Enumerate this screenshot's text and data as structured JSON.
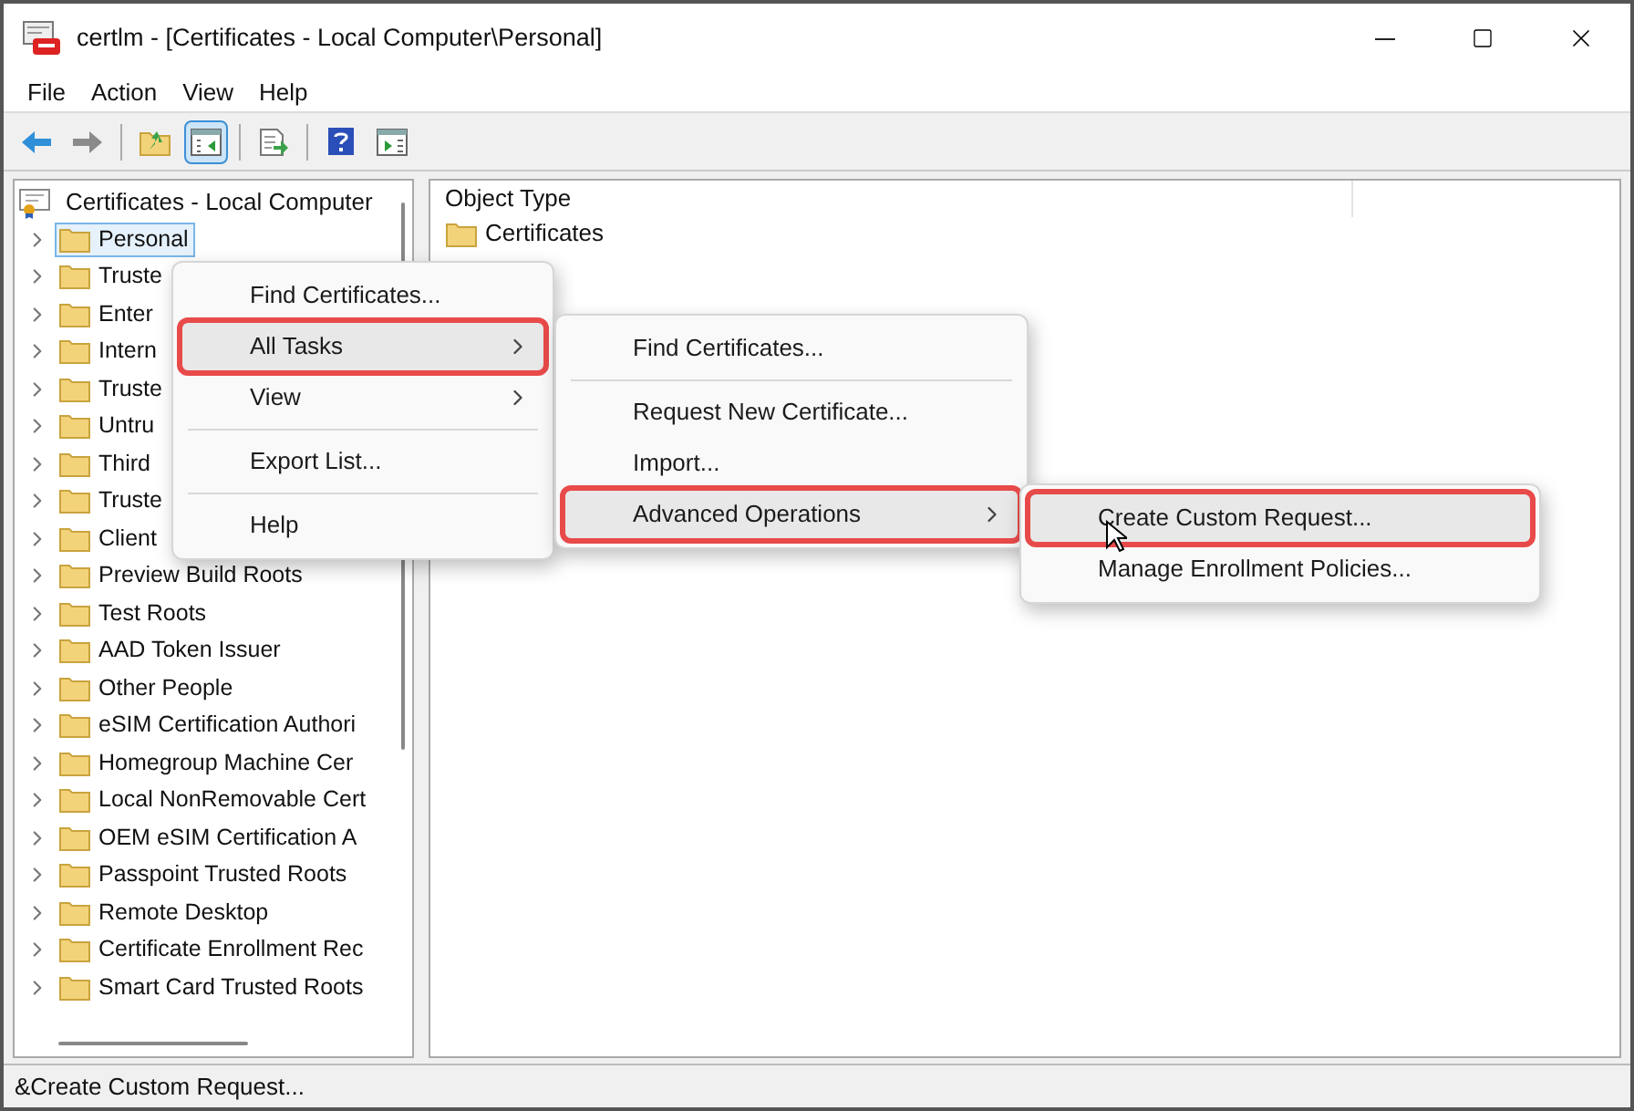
{
  "window": {
    "title": "certlm - [Certificates - Local Computer\\Personal]"
  },
  "menu_bar": [
    "File",
    "Action",
    "View",
    "Help"
  ],
  "toolbar": [
    {
      "kind": "back",
      "selected": false
    },
    {
      "kind": "forward",
      "selected": false
    },
    {
      "kind": "separator"
    },
    {
      "kind": "up",
      "selected": false
    },
    {
      "kind": "tree",
      "selected": true
    },
    {
      "kind": "separator"
    },
    {
      "kind": "export",
      "selected": false
    },
    {
      "kind": "separator"
    },
    {
      "kind": "help",
      "selected": false
    },
    {
      "kind": "action_pane",
      "selected": false
    }
  ],
  "tree": {
    "root": "Certificates - Local Computer",
    "children": [
      {
        "label": "Personal",
        "selected": true
      },
      {
        "label": "Truste",
        "selected": false
      },
      {
        "label": "Enter",
        "selected": false
      },
      {
        "label": "Intern",
        "selected": false
      },
      {
        "label": "Truste",
        "selected": false
      },
      {
        "label": "Untru",
        "selected": false
      },
      {
        "label": "Third",
        "selected": false
      },
      {
        "label": "Truste",
        "selected": false
      },
      {
        "label": "Client",
        "selected": false
      },
      {
        "label": "Preview Build Roots",
        "selected": false
      },
      {
        "label": "Test Roots",
        "selected": false
      },
      {
        "label": "AAD Token Issuer",
        "selected": false
      },
      {
        "label": "Other People",
        "selected": false
      },
      {
        "label": "eSIM Certification Authori",
        "selected": false
      },
      {
        "label": "Homegroup Machine Cer",
        "selected": false
      },
      {
        "label": "Local NonRemovable Cert",
        "selected": false
      },
      {
        "label": "OEM eSIM Certification A",
        "selected": false
      },
      {
        "label": "Passpoint Trusted Roots",
        "selected": false
      },
      {
        "label": "Remote Desktop",
        "selected": false
      },
      {
        "label": "Certificate Enrollment Rec",
        "selected": false
      },
      {
        "label": "Smart Card Trusted Roots",
        "selected": false
      }
    ]
  },
  "list": {
    "columns": [
      "Object Type"
    ],
    "rows": [
      "Certificates"
    ]
  },
  "context_menus": [
    {
      "items": [
        {
          "kind": "item",
          "label": "Find Certificates...",
          "submenu": false,
          "selected": false,
          "outlined": false
        },
        {
          "kind": "item",
          "label": "All Tasks",
          "submenu": true,
          "selected": true,
          "outlined": true
        },
        {
          "kind": "item",
          "label": "View",
          "submenu": true,
          "selected": false,
          "outlined": false
        },
        {
          "kind": "separator"
        },
        {
          "kind": "item",
          "label": "Export List...",
          "submenu": false,
          "selected": false,
          "outlined": false
        },
        {
          "kind": "separator"
        },
        {
          "kind": "item",
          "label": "Help",
          "submenu": false,
          "selected": false,
          "outlined": false
        }
      ]
    },
    {
      "items": [
        {
          "kind": "item",
          "label": "Find Certificates...",
          "submenu": false,
          "selected": false,
          "outlined": false
        },
        {
          "kind": "separator"
        },
        {
          "kind": "item",
          "label": "Request New Certificate...",
          "submenu": false,
          "selected": false,
          "outlined": false
        },
        {
          "kind": "item",
          "label": "Import...",
          "submenu": false,
          "selected": false,
          "outlined": false
        },
        {
          "kind": "item",
          "label": "Advanced Operations",
          "submenu": true,
          "selected": true,
          "outlined": true
        }
      ]
    },
    {
      "items": [
        {
          "kind": "item",
          "label": "Create Custom Request...",
          "submenu": false,
          "selected": true,
          "outlined": true
        },
        {
          "kind": "item",
          "label": "Manage Enrollment Policies...",
          "submenu": false,
          "selected": false,
          "outlined": false
        }
      ]
    }
  ],
  "status_bar": "&Create Custom Request..."
}
